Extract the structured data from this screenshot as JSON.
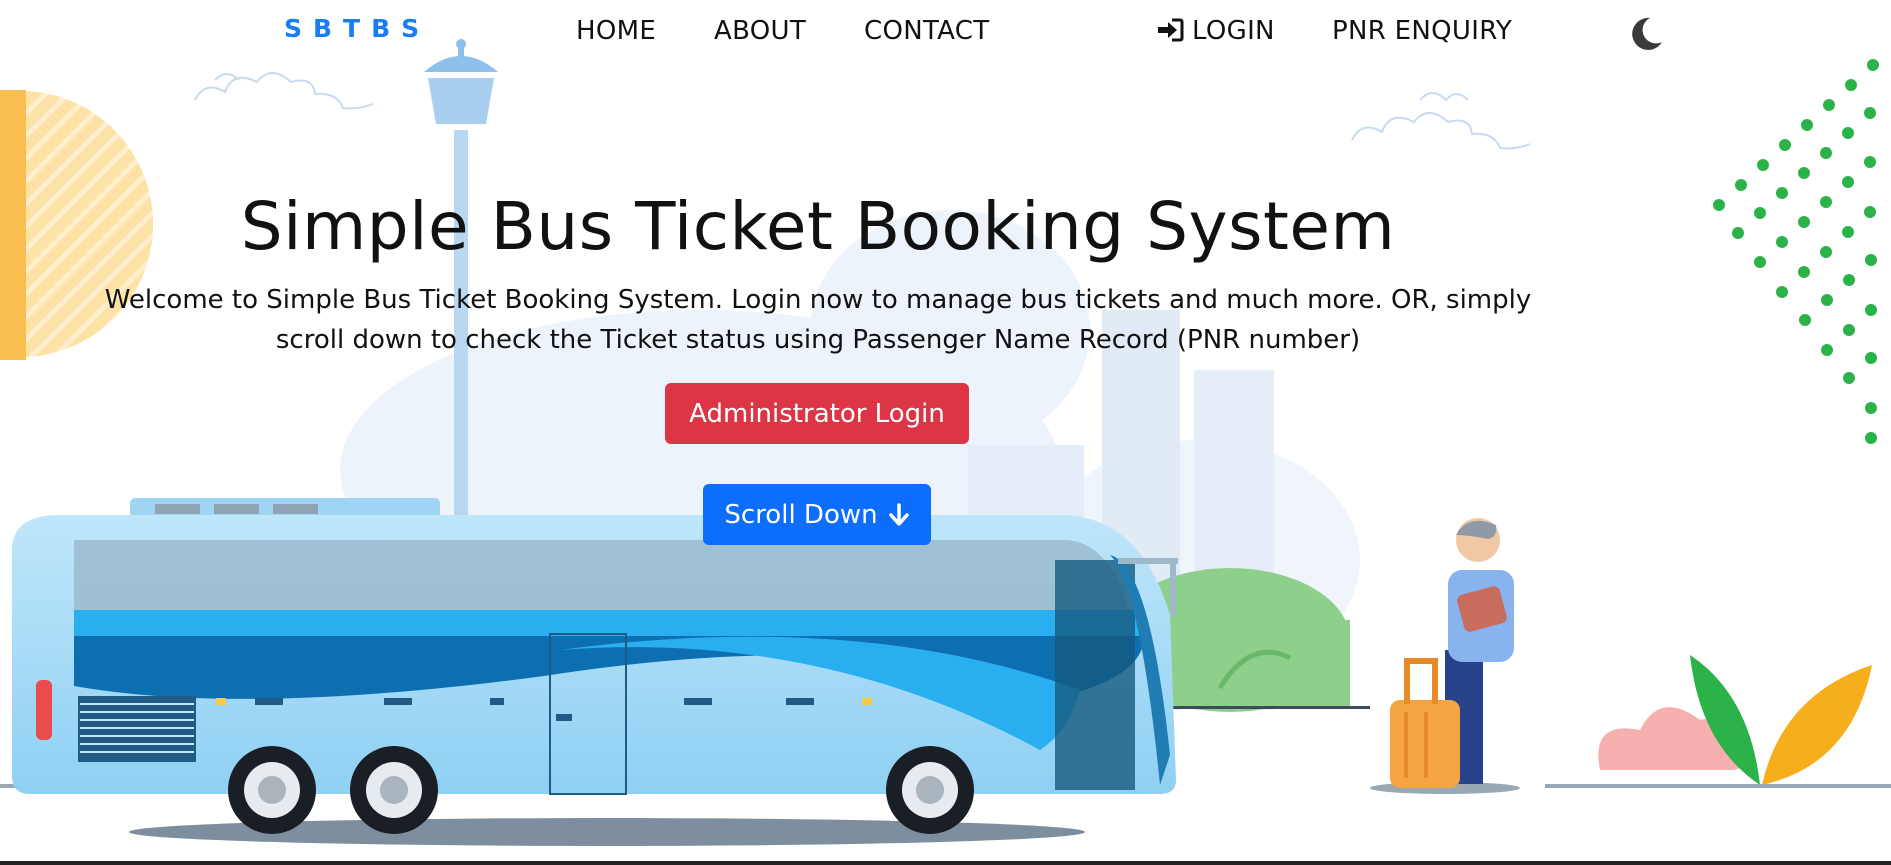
{
  "nav": {
    "brand": "SBTBS",
    "links": {
      "home": "HOME",
      "about": "ABOUT",
      "contact": "CONTACT",
      "login": "LOGIN",
      "pnr": "PNR ENQUIRY"
    },
    "login_icon": "sign-in-icon",
    "theme_icon": "moon-icon"
  },
  "hero": {
    "title": "Simple Bus Ticket Booking System",
    "subtitle": "Welcome to Simple Bus Ticket Booking System. Login now to manage bus tickets and much more. OR, simply scroll down to check the Ticket status using Passenger Name Record (PNR number)",
    "admin_button": "Administrator Login",
    "scroll_button": "Scroll Down",
    "scroll_icon": "arrow-down-icon"
  },
  "colors": {
    "brand": "#1a7ef2",
    "danger": "#dc3545",
    "primary": "#0d6efd",
    "bus": "#29aef0"
  }
}
